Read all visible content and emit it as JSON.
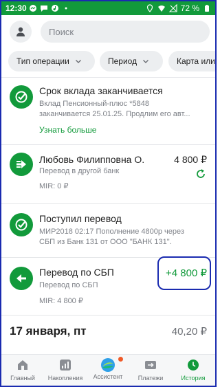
{
  "status_bar": {
    "time": "12:30",
    "battery": "72 %",
    "icons_left": [
      "messenger-icon",
      "chat-icon",
      "music-icon",
      "more-dots-icon"
    ],
    "icons_right": [
      "location-icon",
      "wifi-icon",
      "no-signal-icon",
      "battery-icon"
    ]
  },
  "header": {
    "search_placeholder": "Поиск"
  },
  "filters": [
    {
      "label": "Тип операции"
    },
    {
      "label": "Период"
    },
    {
      "label": "Карта или"
    }
  ],
  "operations": [
    {
      "title": "Срок вклада заканчивается",
      "line1": "Вклад Пенсионный-плюс *5848",
      "line2": "заканчивается 25.01.25. Продлим его авт...",
      "link": "Узнать больше",
      "icon": "check-circle-icon"
    },
    {
      "title": "Любовь Филипповна О.",
      "amount": "4 800 ₽",
      "line1": "Перевод в другой банк",
      "line2": "MIR: 0 ₽",
      "icon": "arrow-right-icon",
      "status_icon": "refresh-icon"
    },
    {
      "title": "Поступил перевод",
      "line1": "МИР2018 02:17 Пополнение 4800р через",
      "line2": "СБП из Банк 131 от ООО \"БАНК 131\".",
      "icon": "check-circle-icon"
    },
    {
      "title": "Перевод по СБП",
      "amount": "+4 800 ₽",
      "line1": "Перевод по СБП",
      "line2": "MIR: 4 800 ₽",
      "icon": "arrow-left-icon"
    }
  ],
  "date_group": {
    "date": "17 января, пт",
    "sum": "40,20 ₽"
  },
  "bottom_nav": [
    {
      "label": "Главный",
      "icon": "home-icon"
    },
    {
      "label": "Накопления",
      "icon": "savings-icon"
    },
    {
      "label": "Ассистент",
      "icon": "assistant-icon"
    },
    {
      "label": "Платежи",
      "icon": "payments-icon"
    },
    {
      "label": "История",
      "icon": "history-icon",
      "active": true
    }
  ],
  "colors": {
    "brand_green": "#129a3b",
    "annotation_blue": "#1a2bb0",
    "badge_orange": "#f05a28"
  }
}
